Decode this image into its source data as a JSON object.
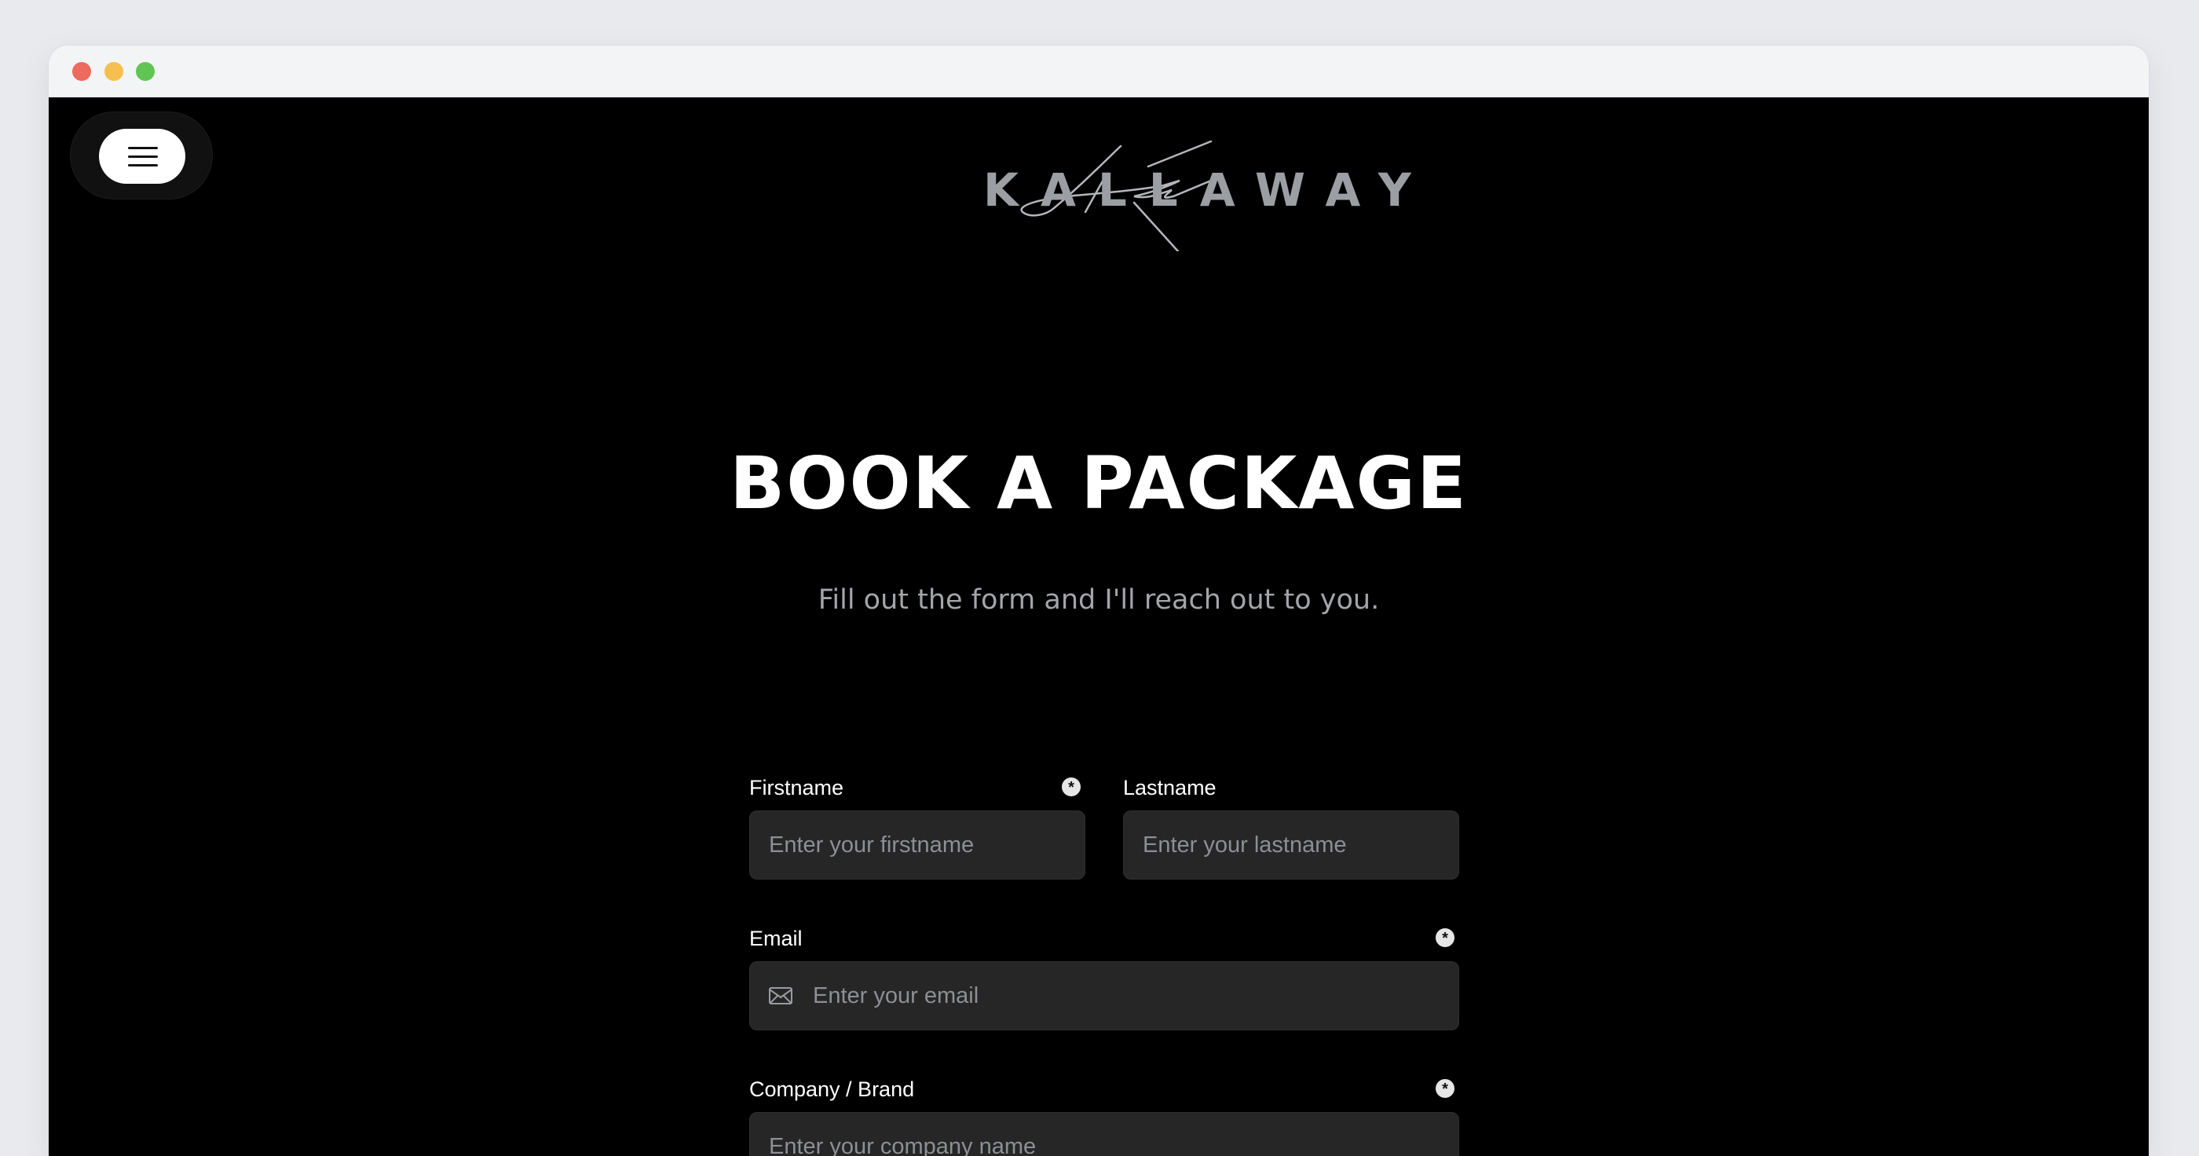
{
  "colors": {
    "traffic_red": "#ed6a5e",
    "traffic_yellow": "#f5bf4f",
    "traffic_green": "#61c554",
    "page_background": "#000000",
    "input_background": "#262626",
    "logo_gray": "#9b9ea3"
  },
  "nav": {
    "menu_icon": "hamburger-icon"
  },
  "logo": {
    "wordmark": "KALLAWAY"
  },
  "hero": {
    "title": "BOOK A PACKAGE",
    "subtitle": "Fill out the form and I'll reach out to you."
  },
  "form": {
    "firstname": {
      "label": "Firstname",
      "placeholder": "Enter your firstname",
      "required_marker": "*"
    },
    "lastname": {
      "label": "Lastname",
      "placeholder": "Enter your lastname"
    },
    "email": {
      "label": "Email",
      "placeholder": "Enter your email",
      "required_marker": "*",
      "icon": "mail-icon"
    },
    "company": {
      "label": "Company / Brand",
      "placeholder": "Enter your company name",
      "required_marker": "*"
    }
  }
}
